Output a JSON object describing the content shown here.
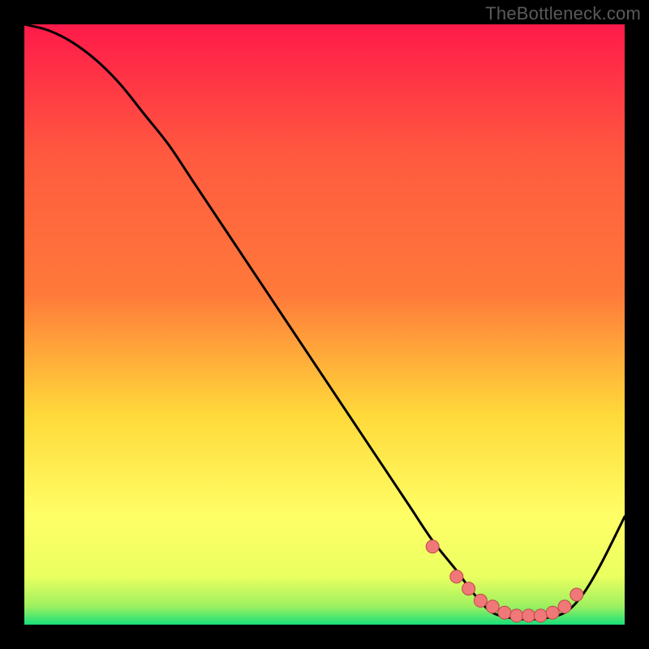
{
  "watermark": "TheBottleneck.com",
  "colors": {
    "gradient_top": "#ff1a4a",
    "gradient_mid1": "#ff7a3a",
    "gradient_mid2": "#ffd93a",
    "gradient_mid3": "#ffff66",
    "gradient_mid4": "#eaff60",
    "gradient_bottom": "#18e07a",
    "curve": "#000000",
    "dot_fill": "#f07878",
    "dot_stroke": "#c04848",
    "frame": "#000000"
  },
  "chart_data": {
    "type": "line",
    "title": "",
    "xlabel": "",
    "ylabel": "",
    "xlim": [
      0,
      100
    ],
    "ylim": [
      0,
      100
    ],
    "grid": false,
    "legend": false,
    "series": [
      {
        "name": "bottleneck-curve",
        "x": [
          0,
          4,
          8,
          12,
          16,
          20,
          24,
          28,
          32,
          36,
          40,
          44,
          48,
          52,
          56,
          60,
          64,
          68,
          72,
          75,
          78,
          82,
          86,
          90,
          93,
          96,
          100
        ],
        "values": [
          100,
          99,
          97,
          94,
          90,
          85,
          80,
          74,
          68,
          62,
          56,
          50,
          44,
          38,
          32,
          26,
          20,
          14,
          9,
          5,
          2,
          1,
          1,
          2,
          5,
          10,
          18
        ]
      }
    ],
    "dots": {
      "name": "highlight-dots",
      "x": [
        68,
        72,
        74,
        76,
        78,
        80,
        82,
        84,
        86,
        88,
        90,
        92
      ],
      "values": [
        13,
        8,
        6,
        4,
        3,
        2,
        1.5,
        1.5,
        1.5,
        2,
        3,
        5
      ]
    }
  }
}
